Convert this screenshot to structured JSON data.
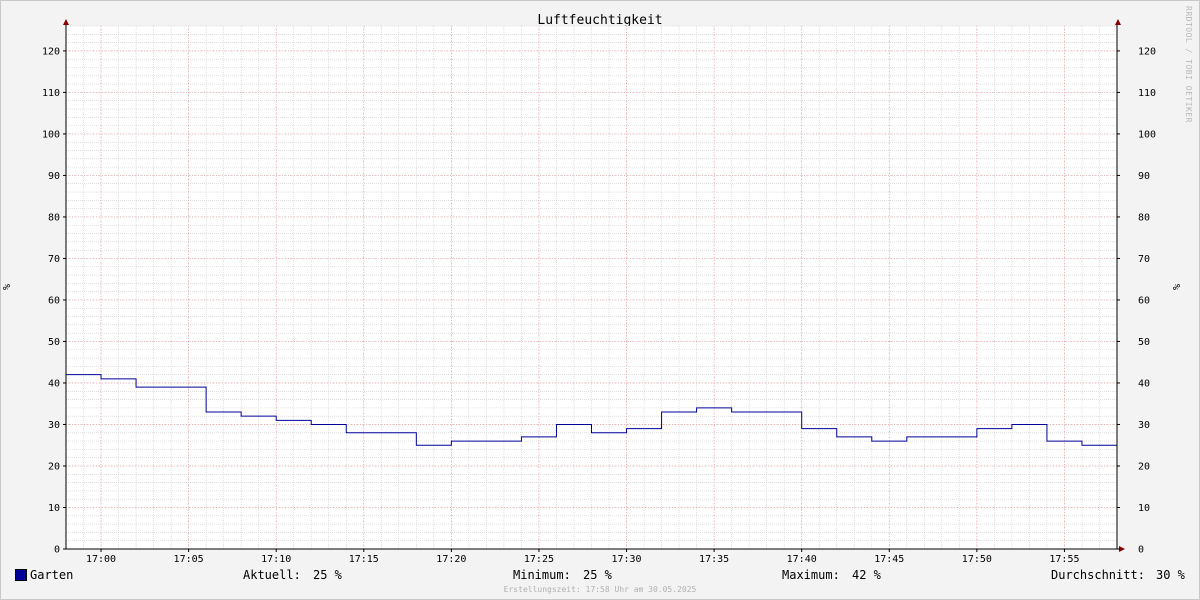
{
  "chart_data": {
    "type": "line",
    "title": "Luftfeuchtigkeit",
    "ylabel": "%",
    "y_unit": "%",
    "ylim": [
      0,
      126
    ],
    "y_ticks": [
      0,
      10,
      20,
      30,
      40,
      50,
      60,
      70,
      80,
      90,
      100,
      110,
      120
    ],
    "x_ticks": [
      "17:00",
      "17:05",
      "17:10",
      "17:15",
      "17:20",
      "17:25",
      "17:30",
      "17:35",
      "17:40",
      "17:45",
      "17:50",
      "17:55"
    ],
    "xlim": [
      "16:58",
      "17:58"
    ],
    "grid": true,
    "step": true,
    "colors": {
      "series": "#000099",
      "major_grid": "#ff9999",
      "minor_grid": "#cccccc",
      "axis": "#000000",
      "arrow": "#880000"
    },
    "series": [
      {
        "name": "Garten",
        "x": [
          "16:58",
          "17:00",
          "17:02",
          "17:04",
          "17:06",
          "17:08",
          "17:10",
          "17:12",
          "17:14",
          "17:16",
          "17:18",
          "17:20",
          "17:22",
          "17:24",
          "17:26",
          "17:28",
          "17:30",
          "17:32",
          "17:34",
          "17:36",
          "17:38",
          "17:40",
          "17:42",
          "17:44",
          "17:46",
          "17:48",
          "17:50",
          "17:52",
          "17:54",
          "17:56",
          "17:58"
        ],
        "values": [
          42,
          41,
          39,
          39,
          33,
          32,
          31,
          30,
          28,
          28,
          25,
          26,
          26,
          27,
          30,
          28,
          29,
          33,
          34,
          33,
          33,
          29,
          27,
          26,
          27,
          27,
          29,
          30,
          26,
          25,
          25
        ]
      }
    ]
  },
  "legend": {
    "series_name": "Garten",
    "current_label": "Aktuell:",
    "current_value": "25 %",
    "min_label": "Minimum:",
    "min_value": "25 %",
    "max_label": "Maximum:",
    "max_value": "42 %",
    "avg_label": "Durchschnitt:",
    "avg_value": "30 %"
  },
  "watermark": "RRDTOOL / TOBI OETIKER",
  "footer": "Erstellungszeit: 17:58 Uhr am 30.05.2025"
}
